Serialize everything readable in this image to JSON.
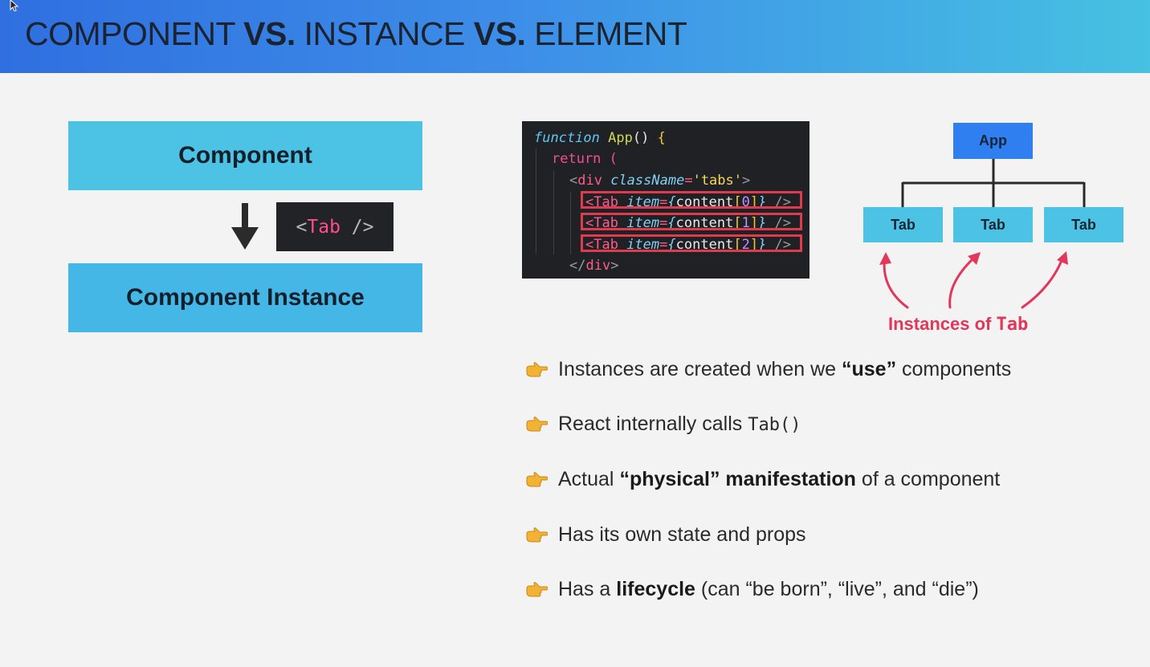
{
  "header": {
    "title_parts": [
      "COMPONENT ",
      "VS.",
      " INSTANCE ",
      "VS.",
      " ELEMENT"
    ]
  },
  "left_diagram": {
    "component_label": "Component",
    "instance_label": "Component Instance",
    "tab_chip_open": "<",
    "tab_chip_name": "Tab",
    "tab_chip_close": " />"
  },
  "code": {
    "line1": {
      "kw": "function",
      "fn": " App",
      "paren": "()",
      "brace": " {"
    },
    "line2": {
      "ret": "return",
      "paren": " ("
    },
    "line3": {
      "open": "<",
      "tag": "div",
      "attr": " className",
      "eq": "=",
      "str": "'tabs'",
      "close": ">"
    },
    "tab_lines": [
      {
        "open": "<",
        "tag": "Tab",
        "attr": " item",
        "eq": "=",
        "lb": "{",
        "obj": "content",
        "lbr": "[",
        "idx": "0",
        "rbr": "]",
        "rb": "}",
        "close": " />"
      },
      {
        "open": "<",
        "tag": "Tab",
        "attr": " item",
        "eq": "=",
        "lb": "{",
        "obj": "content",
        "lbr": "[",
        "idx": "1",
        "rbr": "]",
        "rb": "}",
        "close": " />"
      },
      {
        "open": "<",
        "tag": "Tab",
        "attr": " item",
        "eq": "=",
        "lb": "{",
        "obj": "content",
        "lbr": "[",
        "idx": "2",
        "rbr": "]",
        "rb": "}",
        "close": " />"
      }
    ],
    "line7": {
      "open": "</",
      "tag": "div",
      "close": ">"
    }
  },
  "tree": {
    "root": "App",
    "children": [
      "Tab",
      "Tab",
      "Tab"
    ],
    "caption_prefix": "Instances of ",
    "caption_code": "Tab"
  },
  "bullets": [
    {
      "a": "Instances are created when we ",
      "b": "“use”",
      "c": " components"
    },
    {
      "a": "React internally calls ",
      "code": "Tab()"
    },
    {
      "a": "Actual ",
      "b": "“physical” manifestation",
      "c": " of a component"
    },
    {
      "a": "Has its own state and props"
    },
    {
      "a": "Has a ",
      "b": "lifecycle",
      "c": " (can “be born”, “live”, and “die”)"
    }
  ],
  "colors": {
    "header_gradient": [
      "#2f6fe0",
      "#46c1e2"
    ],
    "component_box": "#4cc3e4",
    "instance_box": "#45b7e6",
    "app_node": "#2f7ff0",
    "highlight_border": "#e03a4f",
    "annotation": "#e2365a",
    "bullet_icon": "#f2b233"
  },
  "icons": [
    "pointing-hand-icon",
    "down-arrow-icon",
    "curved-arrow-icon"
  ]
}
